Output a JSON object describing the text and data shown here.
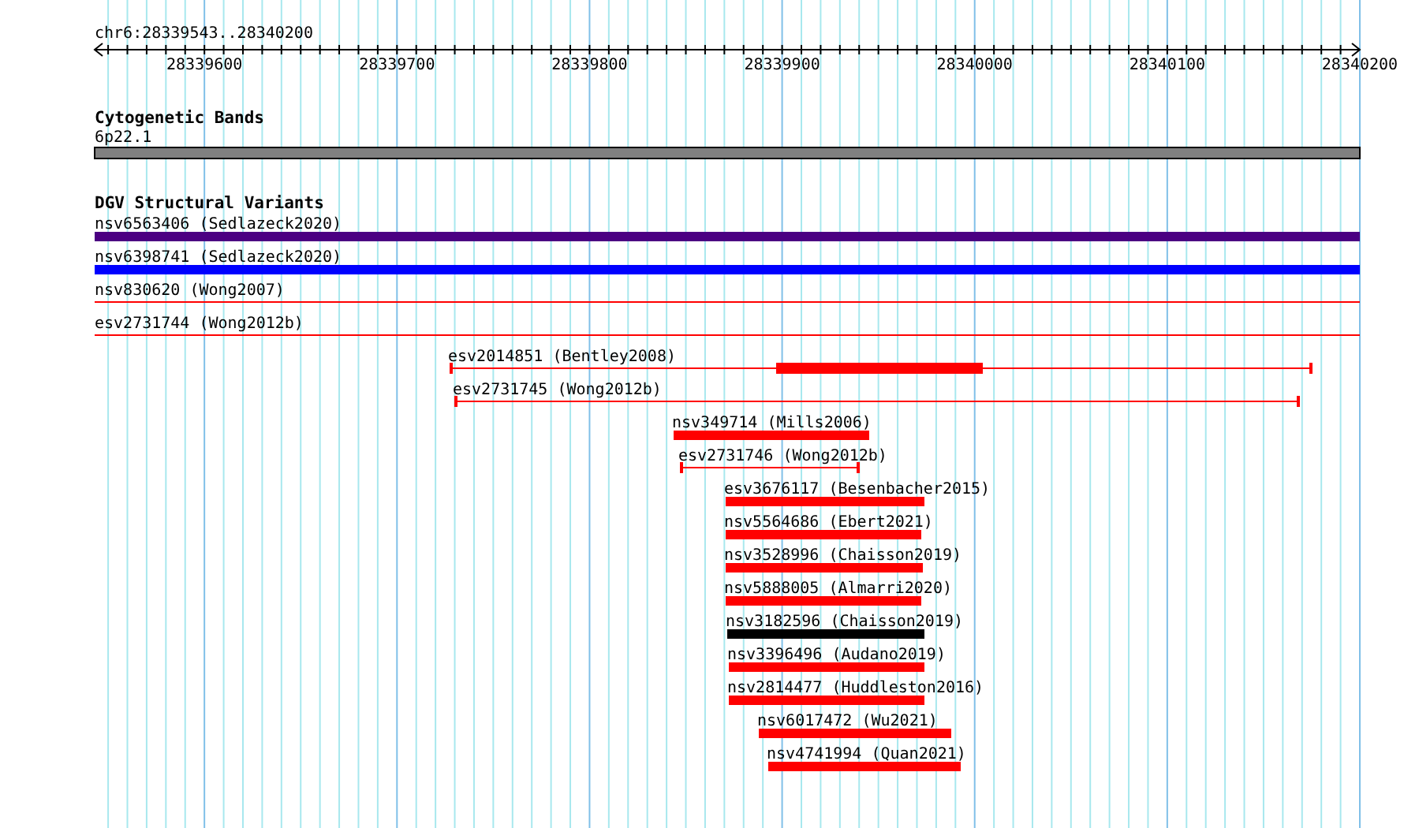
{
  "ruler": {
    "title": "chr6:28339543..28340200",
    "ticks": [
      "28339600",
      "28339700",
      "28339800",
      "28339900",
      "28340000",
      "28340100",
      "28340200"
    ]
  },
  "tracks": [
    {
      "title": "Cytogenetic Bands",
      "features": [
        {
          "label": "6p22.1",
          "kind": "band",
          "color": "#808080"
        }
      ]
    },
    {
      "title": "DGV Structural Variants",
      "features": [
        {
          "label": "nsv6563406 (Sedlazeck2020)",
          "kind": "bar",
          "color": "#4b0082"
        },
        {
          "label": "nsv6398741 (Sedlazeck2020)",
          "kind": "bar",
          "color": "#0000ff"
        },
        {
          "label": "nsv830620 (Wong2007)",
          "kind": "line",
          "color": "#ff0000"
        },
        {
          "label": "esv2731744 (Wong2012b)",
          "kind": "line",
          "color": "#ff0000"
        },
        {
          "label": "esv2014851 (Bentley2008)",
          "kind": "bracket-block",
          "color": "#ff0000"
        },
        {
          "label": "esv2731745 (Wong2012b)",
          "kind": "bracket",
          "color": "#ff0000"
        },
        {
          "label": "nsv349714 (Mills2006)",
          "kind": "bar",
          "color": "#ff0000"
        },
        {
          "label": "esv2731746 (Wong2012b)",
          "kind": "bracket",
          "color": "#ff0000"
        },
        {
          "label": "esv3676117 (Besenbacher2015)",
          "kind": "bar",
          "color": "#ff0000"
        },
        {
          "label": "nsv5564686 (Ebert2021)",
          "kind": "bar",
          "color": "#ff0000"
        },
        {
          "label": "nsv3528996 (Chaisson2019)",
          "kind": "bar",
          "color": "#ff0000"
        },
        {
          "label": "nsv5888005 (Almarri2020)",
          "kind": "bar",
          "color": "#ff0000"
        },
        {
          "label": "nsv3182596 (Chaisson2019)",
          "kind": "bar",
          "color": "#000000"
        },
        {
          "label": "nsv3396496 (Audano2019)",
          "kind": "bar",
          "color": "#ff0000"
        },
        {
          "label": "nsv2814477 (Huddleston2016)",
          "kind": "bar",
          "color": "#ff0000"
        },
        {
          "label": "nsv6017472 (Wu2021)",
          "kind": "bar",
          "color": "#ff0000"
        },
        {
          "label": "nsv4741994 (Quan2021)",
          "kind": "bar",
          "color": "#ff0000"
        }
      ]
    }
  ]
}
